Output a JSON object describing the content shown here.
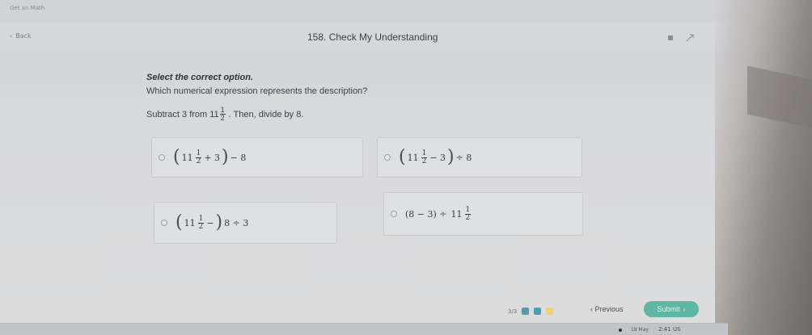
{
  "window": {
    "tab_title": "Get an Math"
  },
  "header": {
    "back_label": "Back",
    "title": "158. Check My Understanding"
  },
  "question": {
    "prompt": "Select the correct option.",
    "text": "Which numerical expression represents the description?",
    "description_prefix": "Subtract 3 from",
    "description_whole": "11",
    "description_num": "1",
    "description_den": "2",
    "description_suffix": ". Then, divide by 8."
  },
  "options": [
    {
      "whole": "11",
      "num": "1",
      "den": "2",
      "op1": "+ 3",
      "after": "− 8"
    },
    {
      "whole": "11",
      "num": "1",
      "den": "2",
      "op1": "− 3",
      "after": "÷ 8"
    },
    {
      "whole": "11",
      "num": "1",
      "den": "2",
      "op1": "−",
      "after": "8 ÷ 3"
    },
    {
      "before": "(8 − 3) ÷",
      "whole": "11",
      "num": "1",
      "den": "2"
    }
  ],
  "footer": {
    "progress": "3/3",
    "previous_label": "Previous",
    "submit_label": "Submit"
  },
  "taskbar": {
    "date": "18 May",
    "time": "2:41 US"
  },
  "colors": {
    "submit": "#5fb6a4",
    "progress_square_1": "#4f9db3",
    "progress_square_2": "#4f9db3",
    "progress_square_3": "#f0d36c"
  }
}
